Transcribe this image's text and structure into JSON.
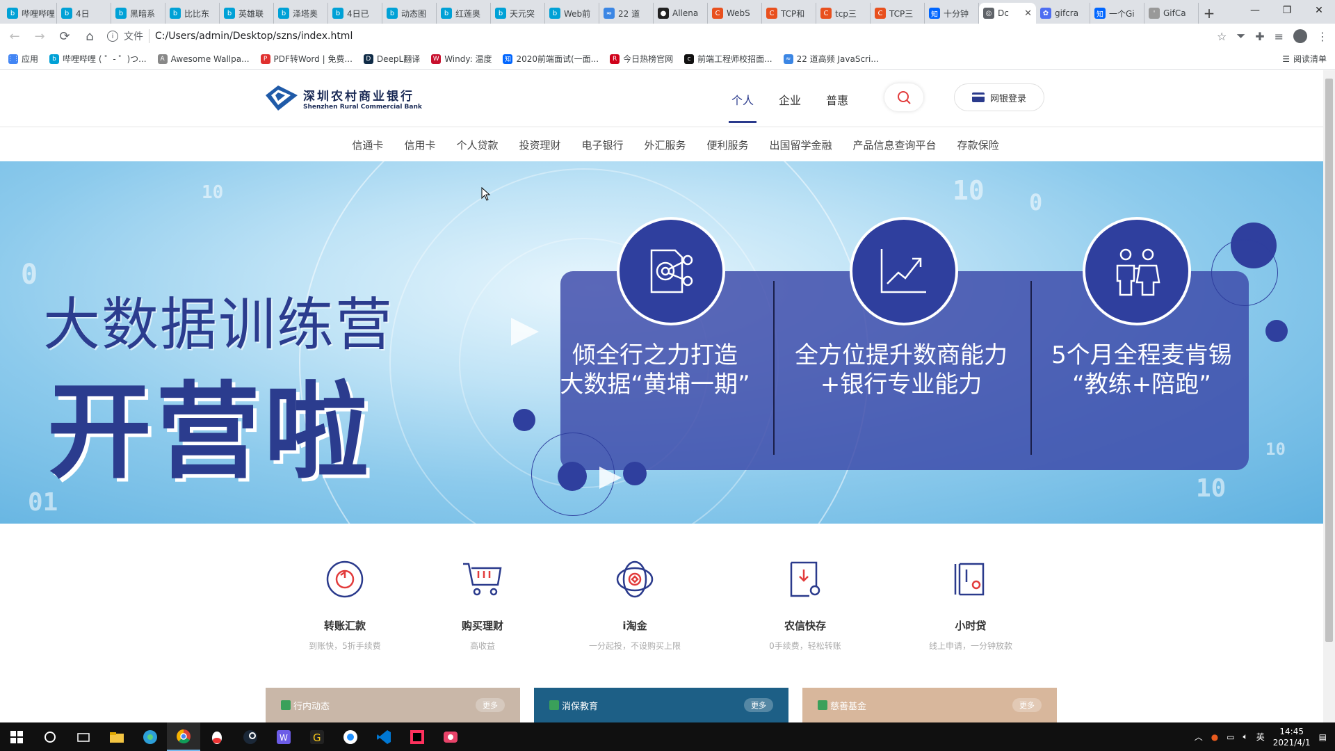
{
  "browser": {
    "tabs": [
      {
        "label": "哔哩哔哩",
        "color": "#00a1d6",
        "glyph": "b"
      },
      {
        "label": "4日",
        "color": "#00a1d6",
        "glyph": "b"
      },
      {
        "label": "黑暗系",
        "color": "#00a1d6",
        "glyph": "b"
      },
      {
        "label": "比比东",
        "color": "#00a1d6",
        "glyph": "b"
      },
      {
        "label": "英雄联",
        "color": "#00a1d6",
        "glyph": "b"
      },
      {
        "label": "泽塔奥",
        "color": "#00a1d6",
        "glyph": "b"
      },
      {
        "label": "4日已",
        "color": "#00a1d6",
        "glyph": "b"
      },
      {
        "label": "动态图",
        "color": "#00a1d6",
        "glyph": "b"
      },
      {
        "label": "红莲奥",
        "color": "#00a1d6",
        "glyph": "b"
      },
      {
        "label": "天元突",
        "color": "#00a1d6",
        "glyph": "b"
      },
      {
        "label": "Web前",
        "color": "#00a1d6",
        "glyph": "b"
      },
      {
        "label": "22 道",
        "color": "#3b86e4",
        "glyph": "≈"
      },
      {
        "label": "Allena",
        "color": "#222222",
        "glyph": "●"
      },
      {
        "label": "WebS",
        "color": "#e8501e",
        "glyph": "C"
      },
      {
        "label": "TCP和",
        "color": "#e8501e",
        "glyph": "C"
      },
      {
        "label": "tcp三",
        "color": "#e8501e",
        "glyph": "C"
      },
      {
        "label": "TCP三",
        "color": "#e8501e",
        "glyph": "C"
      },
      {
        "label": "十分钟",
        "color": "#0066ff",
        "glyph": "知"
      },
      {
        "label": "Dc",
        "color": "#5f6368",
        "glyph": "◎",
        "active": true
      },
      {
        "label": "gifcra",
        "color": "#4e6ef2",
        "glyph": "✿"
      },
      {
        "label": "一个Gi",
        "color": "#0066ff",
        "glyph": "知"
      },
      {
        "label": "GifCa",
        "color": "#999999",
        "glyph": "'"
      }
    ],
    "new_tab": "+",
    "window_controls": [
      "—",
      "❐",
      "✕"
    ],
    "address": {
      "scheme_label": "文件",
      "url": "C:/Users/admin/Desktop/szns/index.html"
    },
    "bookmarks": [
      {
        "label": "应用",
        "color": "#4285f4",
        "glyph": "⋮⋮"
      },
      {
        "label": "哔哩哔哩 ( ゜- ゜)つ...",
        "color": "#00a1d6",
        "glyph": "b"
      },
      {
        "label": "Awesome Wallpa...",
        "color": "#888888",
        "glyph": "A"
      },
      {
        "label": "PDF转Word | 免费...",
        "color": "#e0302f",
        "glyph": "P"
      },
      {
        "label": "DeepL翻译",
        "color": "#0f2b46",
        "glyph": "D"
      },
      {
        "label": "Windy: 温度",
        "color": "#c8102e",
        "glyph": "W"
      },
      {
        "label": "2020前端面试(一面...",
        "color": "#0066ff",
        "glyph": "知"
      },
      {
        "label": "今日热榜官网",
        "color": "#d0021b",
        "glyph": "R"
      },
      {
        "label": "前端工程师校招面...",
        "color": "#111111",
        "glyph": "c"
      },
      {
        "label": "22 道高频 JavaScri...",
        "color": "#3b86e4",
        "glyph": "≈"
      }
    ],
    "reading_list": "阅读清单"
  },
  "site": {
    "logo_cn": "深圳农村商业银行",
    "logo_en": "Shenzhen Rural Commercial Bank",
    "top_nav": [
      "个人",
      "企业",
      "普惠"
    ],
    "login_label": "网银登录",
    "sub_nav": [
      "信通卡",
      "信用卡",
      "个人贷款",
      "投资理财",
      "电子银行",
      "外汇服务",
      "便利服务",
      "出国留学金融",
      "产品信息查询平台",
      "存款保险"
    ],
    "banner": {
      "title_small": "大数据训练营",
      "title_large": "开营啦",
      "features": [
        {
          "line1": "倾全行之力打造",
          "line2": "大数据“黄埔一期”",
          "icon": "document-target-icon"
        },
        {
          "line1": "全方位提升数商能力",
          "line2": "+银行专业能力",
          "icon": "growth-chart-icon"
        },
        {
          "line1": "5个月全程麦肯锡",
          "line2": "“教练+陪跑”",
          "icon": "coach-people-icon"
        }
      ]
    },
    "services": [
      {
        "name": "转账汇款",
        "desc": "到账快，5折手续费",
        "icon": "transfer-icon"
      },
      {
        "name": "购买理财",
        "desc": "高收益",
        "icon": "cart-icon"
      },
      {
        "name": "i淘金",
        "desc": "一分起投，不设购买上限",
        "icon": "gold-icon"
      },
      {
        "name": "农信快存",
        "desc": "0手续费，轻松转账",
        "icon": "deposit-icon"
      },
      {
        "name": "小时贷",
        "desc": "线上申请，一分钟放款",
        "icon": "loan-icon"
      }
    ],
    "news_cards": [
      {
        "title": "行内动态",
        "more": "更多",
        "bg": "#c9b7a8"
      },
      {
        "title": "消保教育",
        "more": "更多",
        "bg": "#1d5f86"
      },
      {
        "title": "慈善基金",
        "more": "更多",
        "bg": "#d8b79c"
      }
    ]
  },
  "taskbar": {
    "time": "14:45",
    "date": "2021/4/1",
    "ime": "英"
  },
  "colors": {
    "brand": "#2a3a8c",
    "banner_text": "#2b3c8e",
    "search_red": "#e23b3b"
  }
}
